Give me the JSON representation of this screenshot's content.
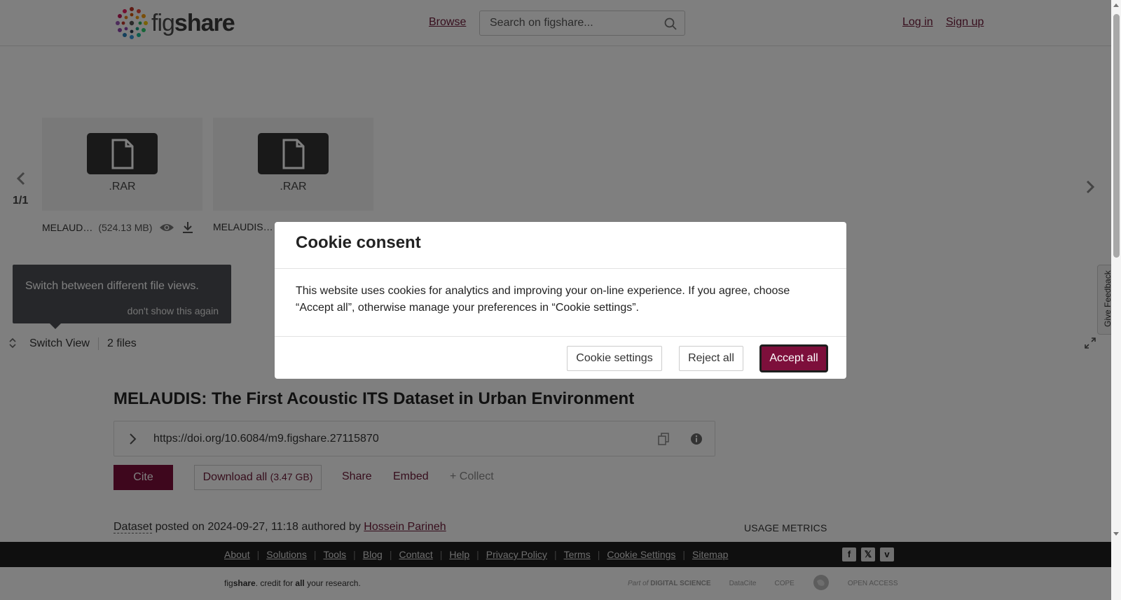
{
  "header": {
    "logo_text_fig": "fig",
    "logo_text_share": "share",
    "browse_label": "Browse",
    "search_placeholder": "Search on figshare...",
    "login_label": "Log in",
    "signup_label": "Sign up"
  },
  "viewer": {
    "pager": "1/1",
    "files": [
      {
        "ext": ".RAR",
        "name": "MELAUD…",
        "size": "(524.13 MB)"
      },
      {
        "ext": ".RAR",
        "name": "MELAUDIS…",
        "size": ""
      }
    ],
    "tooltip": {
      "text": "Switch between different file views.",
      "dismiss": "don't show this again"
    },
    "toolbar": {
      "switch_view": "Switch View",
      "files_count": "2 files"
    }
  },
  "content": {
    "title": "MELAUDIS: The First Acoustic ITS Dataset in Urban Environment",
    "doi": "https://doi.org/10.6084/m9.figshare.27115870",
    "cite_label": "Cite",
    "download_label": "Download all",
    "download_size": "(3.47 GB)",
    "share_label": "Share",
    "embed_label": "Embed",
    "collect_label": "+ Collect",
    "item_type": "Dataset",
    "posted_text": " posted on 2024-09-27, 11:18 authored by ",
    "author": "Hossein Parineh",
    "usage_metrics": "USAGE METRICS"
  },
  "footer": {
    "links": [
      "About",
      "Solutions",
      "Tools",
      "Blog",
      "Contact",
      "Help",
      "Privacy Policy",
      "Terms",
      "Cookie Settings",
      "Sitemap"
    ],
    "credit_fig": "fig",
    "credit_share": "share",
    "credit_mid": ". credit for ",
    "credit_all": "all",
    "credit_end": " your research.",
    "partner_part_of": "Part of",
    "partner_ds": "DIGITAL SCIENCE",
    "partner_datacite": "DataCite",
    "partner_cope": "COPE",
    "partner_oa": "OPEN ACCESS"
  },
  "modal": {
    "title": "Cookie consent",
    "body": "This website uses cookies for analytics and improving your on-line experience. If you agree, choose “Accept all”, otherwise manage your preferences in “Cookie settings”.",
    "settings_label": "Cookie settings",
    "reject_label": "Reject all",
    "accept_label": "Accept all"
  },
  "feedback_label": "Give Feedback",
  "colors": {
    "brand": "#7d0f3b",
    "link": "#6d1a38",
    "overlay": "rgba(0,0,0,0.5)"
  }
}
